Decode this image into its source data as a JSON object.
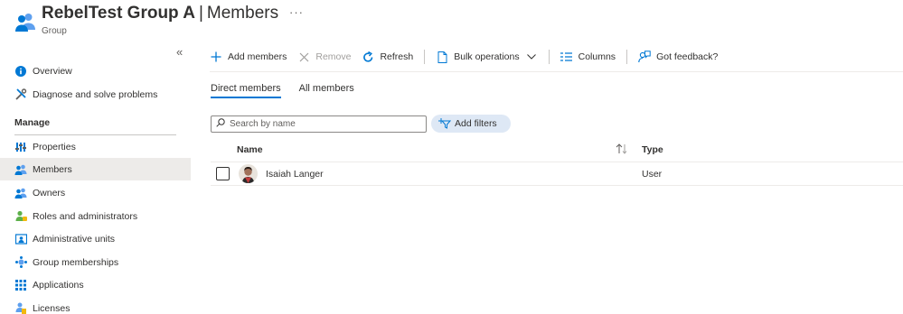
{
  "header": {
    "title": "RebelTest Group A",
    "separator": "|",
    "page": "Members",
    "subtitle": "Group",
    "more": "···"
  },
  "sidebar": {
    "collapse": "«",
    "items": [
      {
        "label": "Overview",
        "icon": "info-icon"
      },
      {
        "label": "Diagnose and solve problems",
        "icon": "wrench-icon"
      }
    ],
    "section": "Manage",
    "manage_items": [
      {
        "label": "Properties",
        "icon": "properties-icon"
      },
      {
        "label": "Members",
        "icon": "members-icon",
        "selected": true
      },
      {
        "label": "Owners",
        "icon": "owners-icon"
      },
      {
        "label": "Roles and administrators",
        "icon": "roles-icon"
      },
      {
        "label": "Administrative units",
        "icon": "admin-units-icon"
      },
      {
        "label": "Group memberships",
        "icon": "group-memberships-icon"
      },
      {
        "label": "Applications",
        "icon": "applications-icon"
      },
      {
        "label": "Licenses",
        "icon": "licenses-icon"
      }
    ]
  },
  "toolbar": {
    "add_members": "Add members",
    "remove": "Remove",
    "refresh": "Refresh",
    "bulk_operations": "Bulk operations",
    "columns": "Columns",
    "feedback": "Got feedback?"
  },
  "tabs": {
    "direct": "Direct members",
    "all": "All members"
  },
  "search": {
    "placeholder": "Search by name",
    "value": ""
  },
  "filters": {
    "add_filters": "Add filters"
  },
  "table": {
    "columns": {
      "name": "Name",
      "type": "Type"
    },
    "rows": [
      {
        "name": "Isaiah Langer",
        "type": "User"
      }
    ]
  },
  "colors": {
    "accent": "#0078d4",
    "selected_bg": "#edebe9",
    "filter_bg": "#dee8f5"
  }
}
